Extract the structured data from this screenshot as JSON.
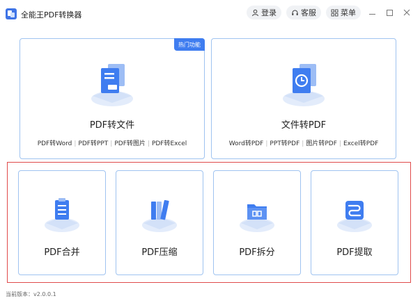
{
  "app": {
    "title": "全能王PDF转换器"
  },
  "titlebar": {
    "login_label": "登录",
    "service_label": "客服",
    "menu_label": "菜单"
  },
  "cards_big": [
    {
      "title": "PDF转文件",
      "icon": "pdf-file-icon",
      "badge": "热门功能",
      "subs": [
        "PDF转Word",
        "PDF转PPT",
        "PDF转图片",
        "PDF转Excel"
      ]
    },
    {
      "title": "文件转PDF",
      "icon": "file-to-pdf-icon",
      "subs": [
        "Word转PDF",
        "PPT转PDF",
        "图片转PDF",
        "Excel转PDF"
      ]
    }
  ],
  "cards_small": [
    {
      "title": "PDF合并",
      "icon": "clipboard-list-icon"
    },
    {
      "title": "PDF压缩",
      "icon": "books-icon"
    },
    {
      "title": "PDF拆分",
      "icon": "folder-split-icon"
    },
    {
      "title": "PDF提取",
      "icon": "extract-path-icon"
    }
  ],
  "footer": {
    "version": "当前版本：v2.0.0.1"
  },
  "colors": {
    "accent": "#3f7df0",
    "card_border": "#9fc3f0",
    "highlight": "#e04a4a"
  }
}
